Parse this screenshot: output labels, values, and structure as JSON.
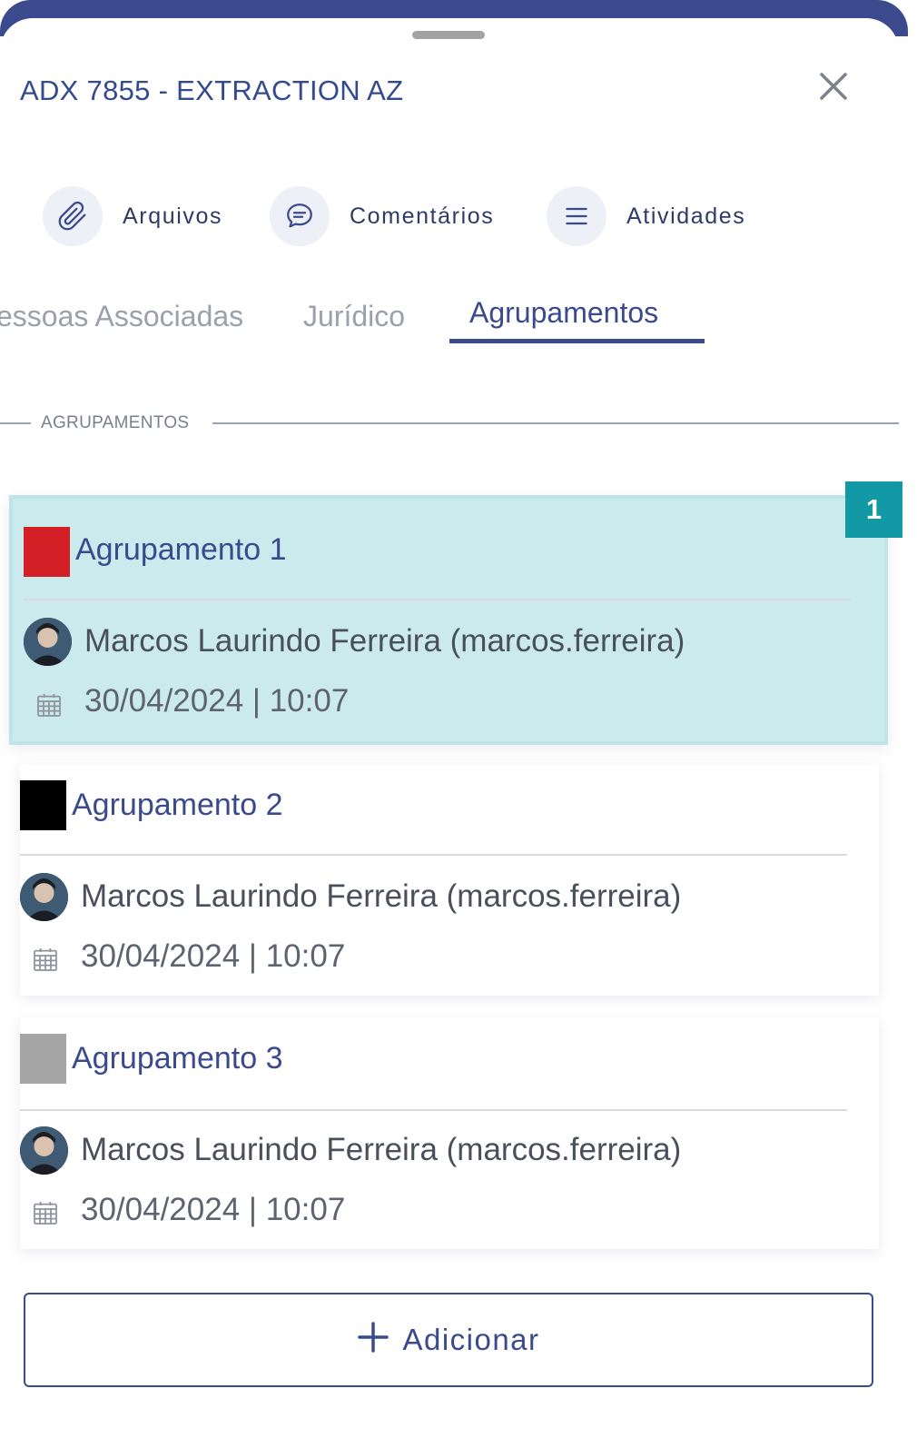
{
  "header": {
    "title": "ADX 7855 - EXTRACTION AZ",
    "close_icon": "close-icon"
  },
  "actions": [
    {
      "label": "Arquivos",
      "icon": "paperclip-icon"
    },
    {
      "label": "Comentários",
      "icon": "comment-icon"
    },
    {
      "label": "Atividades",
      "icon": "list-icon"
    }
  ],
  "tabs": [
    {
      "label": "essoas Associadas",
      "active": false
    },
    {
      "label": "Jurídico",
      "active": false
    },
    {
      "label": "Agrupamentos",
      "active": true
    }
  ],
  "section": {
    "label": "AGRUPAMENTOS"
  },
  "groups": [
    {
      "name": "Agrupamento 1",
      "color": "#d32026",
      "user": "Marcos Laurindo Ferreira (marcos.ferreira)",
      "datetime": "30/04/2024 | 10:07",
      "selected": true
    },
    {
      "name": "Agrupamento 2",
      "color": "#000000",
      "user": "Marcos Laurindo Ferreira (marcos.ferreira)",
      "datetime": "30/04/2024 | 10:07",
      "selected": false
    },
    {
      "name": "Agrupamento 3",
      "color": "#a6a6a6",
      "user": "Marcos Laurindo Ferreira (marcos.ferreira)",
      "datetime": "30/04/2024 | 10:07",
      "selected": false
    }
  ],
  "badge": {
    "text": "1"
  },
  "add_button": {
    "label": "Adicionar",
    "icon": "plus-icon"
  },
  "colors": {
    "accent": "#3a4a8c",
    "badge": "#1399a5",
    "selected_bg": "#cbeaee"
  }
}
